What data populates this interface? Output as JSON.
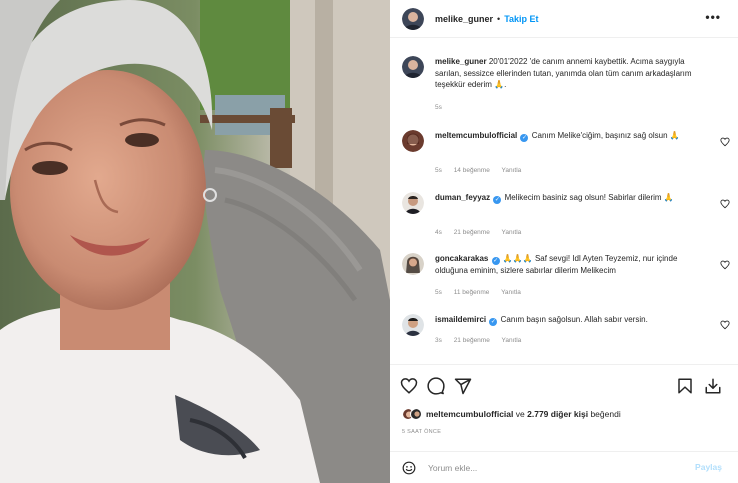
{
  "post": {
    "username": "melike_guner",
    "dot": "•",
    "follow_label": "Takip Et",
    "more_label": "•••",
    "photo_alt": "photo"
  },
  "caption": {
    "username": "melike_guner",
    "text": "20'01'2022 'de canım annemi kaybettik. Acıma saygıyla sarılan, sessizce ellerinden tutan, yanımda olan tüm canım arkadaşlarım teşekkür ederim 🙏.",
    "time": "5s"
  },
  "comments": [
    {
      "username": "meltemcumbulofficial",
      "verified": true,
      "text": "Canım Melike'ciğim, başınız sağ olsun 🙏",
      "time": "5s",
      "likes": "14 beğenme",
      "reply": "Yanıtla"
    },
    {
      "username": "duman_feyyaz",
      "verified": true,
      "text": "Melikecim basiniz sag olsun! Sabirlar dilerim 🙏",
      "time": "4s",
      "likes": "21 beğenme",
      "reply": "Yanıtla"
    },
    {
      "username": "goncakarakas",
      "verified": true,
      "text": "🙏🙏🙏 Saf sevgi! Idl Ayten Teyzemiz, nur içinde olduğuna eminim, sizlere sabırlar dilerim Melikecim",
      "time": "5s",
      "likes": "11 beğenme",
      "reply": "Yanıtla"
    },
    {
      "username": "ismaildemirci",
      "verified": true,
      "text": "Canım başın sağolsun. Allah sabır versin.",
      "time": "3s",
      "likes": "21 beğenme",
      "reply": "Yanıtla"
    }
  ],
  "likes_line": {
    "first_user": "meltemcumbulofficial",
    "joiner": "ve",
    "others": "2.779 diğer kişi",
    "suffix": "beğendi"
  },
  "time_ago": "5 SAAT ÖNCE",
  "add_comment": {
    "placeholder": "Yorum ekle...",
    "post_label": "Paylaş"
  },
  "icons": {
    "like": "heart-icon",
    "comment": "comment-icon",
    "share": "paper-plane-icon",
    "save": "bookmark-icon",
    "download": "download-icon",
    "emoji": "smiley-icon",
    "more": "ellipsis-icon"
  },
  "colors": {
    "link_blue": "#0095f6",
    "verified_blue": "#3897f0",
    "muted_gray": "#8e8e8e",
    "disabled_blue": "#b2dffc",
    "text": "#262626"
  }
}
